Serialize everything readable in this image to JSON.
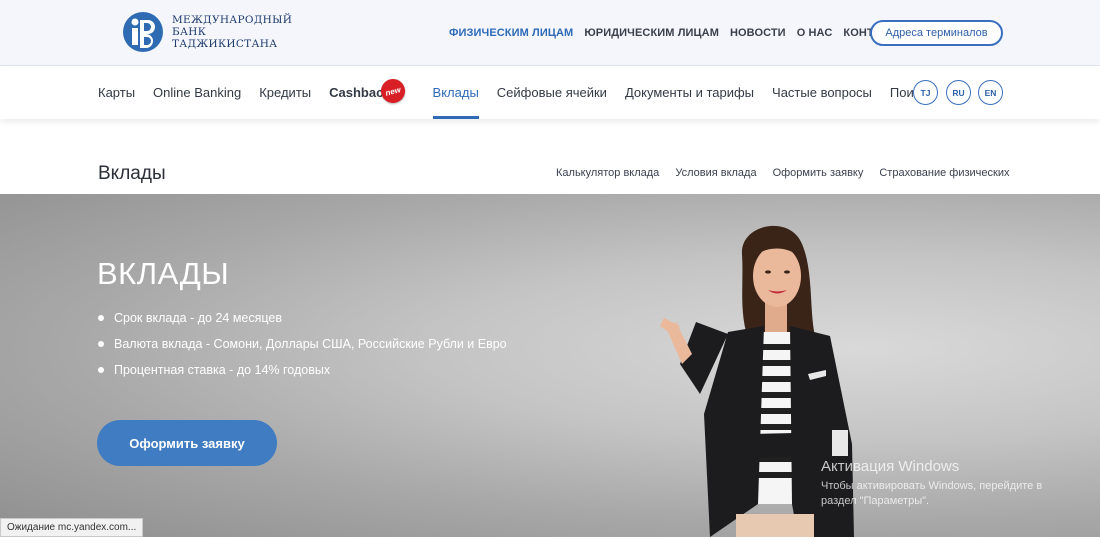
{
  "logo": {
    "line1": "МЕЖДУНАРОДНЫЙ",
    "line2": "БАНК",
    "line3": "ТАДЖИКИСТАНА"
  },
  "top_nav": {
    "items": [
      {
        "label": "ФИЗИЧЕСКИМ ЛИЦАМ",
        "active": true
      },
      {
        "label": "ЮРИДИЧЕСКИМ ЛИЦАМ",
        "active": false
      },
      {
        "label": "НОВОСТИ",
        "active": false
      },
      {
        "label": "О НАС",
        "active": false
      },
      {
        "label": "КОНТАКТЫ",
        "active": false
      }
    ],
    "terminals_label": "Адреса терминалов"
  },
  "main_nav": {
    "items": [
      {
        "label": "Карты"
      },
      {
        "label": "Online Banking"
      },
      {
        "label": "Кредиты"
      },
      {
        "label": "Cashback"
      },
      {
        "label": "Вклады"
      },
      {
        "label": "Сейфовые ячейки"
      },
      {
        "label": "Документы и тарифы"
      },
      {
        "label": "Частые вопросы"
      },
      {
        "label": "Поиск"
      }
    ],
    "new_badge": "new",
    "languages": [
      "TJ",
      "RU",
      "EN"
    ]
  },
  "section": {
    "title": "Вклады",
    "sub_nav": [
      "Калькулятор вклада",
      "Условия вклада",
      "Оформить заявку",
      "Страхование физических"
    ]
  },
  "hero": {
    "title": "ВКЛАДЫ",
    "bullets": [
      "Срок вклада - до 24 месяцев",
      "Валюта вклада - Сомони, Доллары США, Российские Рубли и Евро",
      "Процентная ставка - до 14% годовых"
    ],
    "button_label": "Оформить заявку"
  },
  "watermark": {
    "title": "Активация Windows",
    "line1": "Чтобы активировать Windows, перейдите в",
    "line2": "раздел \"Параметры\"."
  },
  "status_bar": "Ожидание mc.yandex.com...",
  "colors": {
    "accent": "#2e6ab8",
    "button": "#3f7cc2",
    "badge": "#d81f26"
  }
}
